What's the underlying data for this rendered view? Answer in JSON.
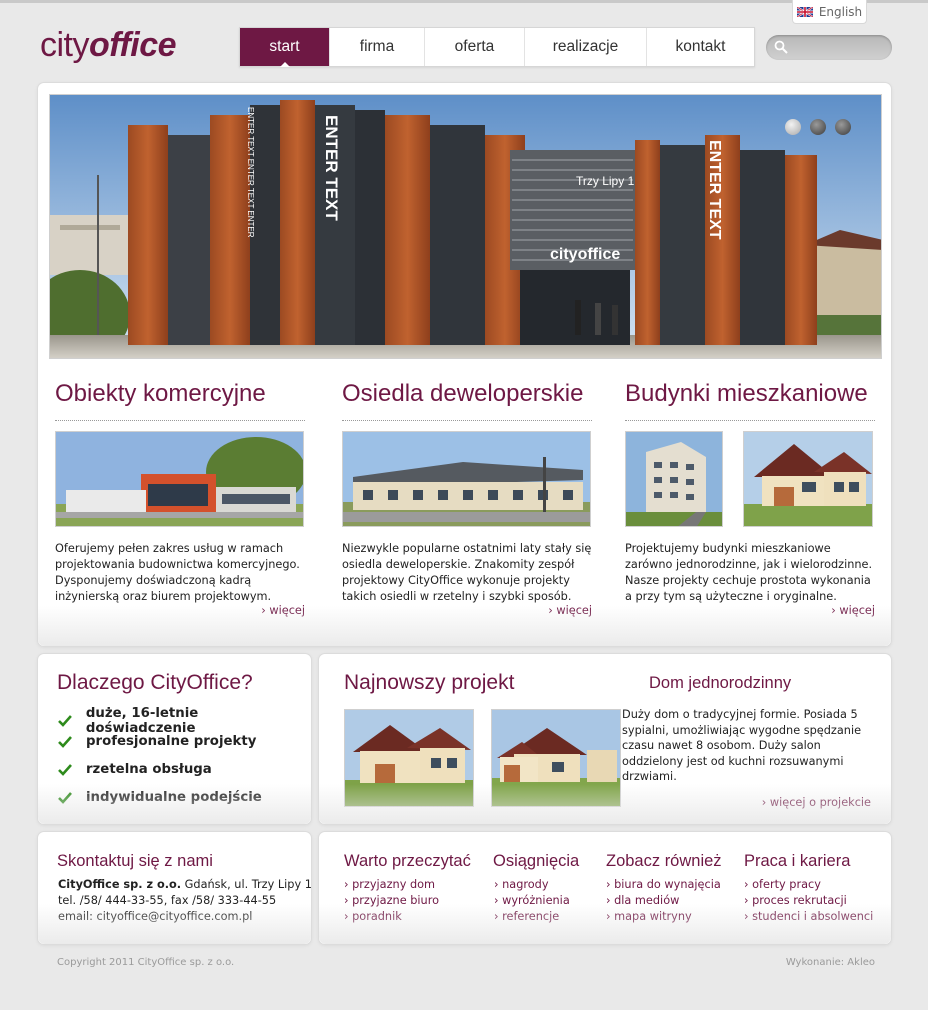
{
  "header": {
    "lang_label": "English",
    "logo": {
      "part1": "city",
      "part2": "office"
    },
    "nav": [
      {
        "label": "start",
        "active": true
      },
      {
        "label": "firma",
        "active": false
      },
      {
        "label": "oferta",
        "active": false
      },
      {
        "label": "realizacje",
        "active": false
      },
      {
        "label": "kontakt",
        "active": false
      }
    ],
    "search_placeholder": ""
  },
  "banner": {
    "sign_text": "Trzy Lipy 1",
    "brand_text": "cityoffice",
    "enter_text": "ENTER TEXT",
    "enter_text_small": "ENTER TEXT ENTER TEXT ENTER",
    "slides": 3,
    "active_slide": 1
  },
  "columns": [
    {
      "title": "Obiekty komercyjne",
      "text": "Oferujemy pełen zakres usług w ramach projektowania budownictwa komercyjnego. Dysponujemy doświadczoną kadrą inżynierską oraz biurem projektowym.",
      "more": "więcej"
    },
    {
      "title": "Osiedla deweloperskie",
      "text": "Niezwykle popularne ostatnimi laty stały się osiedla deweloperskie. Znakomity zespół projektowy CityOffice wykonuje projekty takich osiedli w rzetelny i szybki sposób.",
      "more": "więcej"
    },
    {
      "title": "Budynki mieszkaniowe",
      "text": "Projektujemy budynki mieszkaniowe zarówno jednorodzinne, jak i wielorodzinne. Nasze projekty cechuje prostota wykonania a przy tym są użyteczne i oryginalne.",
      "more": "więcej"
    }
  ],
  "why": {
    "title": "Dlaczego CityOffice?",
    "items": [
      "duże, 16-letnie doświadczenie",
      "profesjonalne projekty",
      "rzetelna obsługa",
      "indywidualne podejście"
    ]
  },
  "latest": {
    "title": "Najnowszy projekt",
    "subtitle": "Dom jednorodzinny",
    "text": "Duży dom o tradycyjnej formie. Posiada 5 sypialni, umożliwiając wygodne spędzanie czasu nawet 8 osobom. Duży salon oddzielony jest od kuchni rozsuwanymi drzwiami.",
    "more": "więcej o projekcie"
  },
  "contact": {
    "title": "Skontaktuj się z nami",
    "company": "CityOffice sp. z o.o.",
    "address": " Gdańsk, ul. Trzy Lipy 1",
    "phone": "tel. /58/ 444-33-55, fax /58/ 333-44-55",
    "email": "email: cityoffice@cityoffice.com.pl"
  },
  "link_columns": [
    {
      "title": "Warto przeczytać",
      "links": [
        "przyjazny dom",
        "przyjazne biuro",
        "poradnik"
      ]
    },
    {
      "title": "Osiągnięcia",
      "links": [
        "nagrody",
        "wyróżnienia",
        "referencje"
      ]
    },
    {
      "title": "Zobacz również",
      "links": [
        "biura do wynajęcia",
        "dla mediów",
        "mapa witryny"
      ]
    },
    {
      "title": "Praca i kariera",
      "links": [
        "oferty pracy",
        "proces rekrutacji",
        "studenci i absolwenci"
      ]
    }
  ],
  "footer": {
    "copyright": "Copyright 2011 CityOffice sp. z o.o.",
    "credit": "Wykonanie: Akleo"
  },
  "colors": {
    "brand": "#6e1844",
    "accent_check": "#2e8b1c",
    "background": "#e9e9e9"
  }
}
